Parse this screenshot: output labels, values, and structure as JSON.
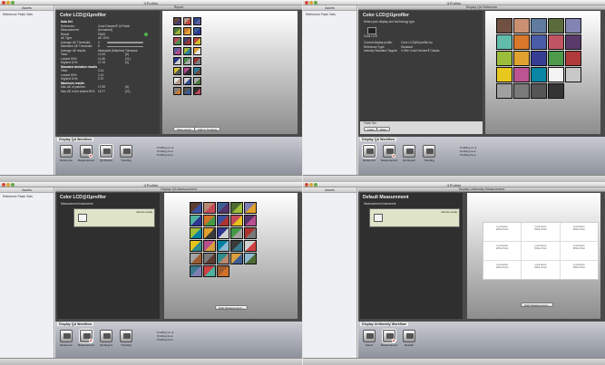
{
  "app": {
    "window_title": "i1Profiler",
    "sidebar_header": "Assets",
    "sidebar_item": "Reference Patch Sets"
  },
  "q1": {
    "header": "Report",
    "panel_title": "Color LCD@i1profiler",
    "rows": [
      {
        "label": "Data Set",
        "v": ""
      },
      {
        "label": "Reference:",
        "v": "ColorChecker® 24 Patch"
      },
      {
        "label": "Measurement:",
        "v": "(Unnamed)"
      },
      {
        "label": "Result",
        "v": "PASS"
      },
      {
        "label": "ΔE Type:",
        "v": "ΔE 1976"
      },
      {
        "label": "Average ΔE Threshold:",
        "v": "3"
      },
      {
        "label": "Maximum ΔE Threshold:",
        "v": "6"
      },
      {
        "label": "Average ΔE results",
        "v": "Measured (Matches)",
        "v2": "Tolerance"
      },
      {
        "label": "Total:",
        "v": "12.49",
        "v2": "(6)"
      },
      {
        "label": "Lowest 90%:",
        "v": "11.66",
        "v2": "(21)"
      },
      {
        "label": "Highest 10%:",
        "v": "17.15",
        "v2": "(3)"
      },
      {
        "label": "Standard deviation results",
        "v": ""
      },
      {
        "label": "Total:",
        "v": "3.14"
      },
      {
        "label": "Lowest 90%:",
        "v": "2.13"
      },
      {
        "label": "Highest 10%:",
        "v": "0.70"
      },
      {
        "label": "Maximum results",
        "v": ""
      },
      {
        "label": "Max ΔE of patches:",
        "v": "17.89",
        "v2": "(6)"
      },
      {
        "label": "Max ΔE in the lowest 90%:",
        "v": "15.77",
        "v2": "(21)"
      }
    ],
    "buttons": {
      "save": "Save report...",
      "trending": "Add to Trending"
    },
    "workflow_title": "Display QA Workflow",
    "steps": [
      "Reference",
      "Measurement",
      "QA Report",
      "Trending"
    ],
    "opts": [
      "Profiling mo",
      "Profiling ba",
      "Profiling ba"
    ],
    "colors": [
      "#6b4b3b",
      "#b89a8a",
      "#2f4a8f",
      "#4c7a3a",
      "#c87a2e",
      "#3b5c9c",
      "#ba4a5c",
      "#4a3f70",
      "#bd463c",
      "#5e5e9e",
      "#9fb23c",
      "#e3a23a",
      "#2d3a8f",
      "#4d8d4a",
      "#9a3535",
      "#d4bf2c",
      "#b14a8c",
      "#2c7d9a",
      "#e7e7e7",
      "#cfcfcf",
      "#a9a9a9",
      "#7c7c7c",
      "#555",
      "#2f2f2f"
    ]
  },
  "q2": {
    "header": "Display QA Reference",
    "panel_title": "Color LCD@i1profiler",
    "sub": "Select your display and technology type",
    "display_label": "Color LCD",
    "rows": [
      {
        "label": "Current display profile:",
        "v": "Color LCD@i1profiler.icc"
      },
      {
        "label": "Reference Type:",
        "v": "Standard"
      },
      {
        "label": "Industry Standard Targets:",
        "v": "X-Rite ColorChecker® Classic"
      }
    ],
    "buttons": {
      "load": "Load",
      "save": "Save"
    },
    "patch_set": "Patch Set",
    "workflow_title": "Display QA Workflow",
    "steps": [
      "Reference",
      "Measurement",
      "QA Report",
      "Trending"
    ],
    "opts": [
      "Profiling mo",
      "Profiling ba",
      "Profiling ba"
    ],
    "colors": [
      "#705040",
      "#c99172",
      "#5f7c9e",
      "#5a6c3c",
      "#8284b4",
      "#62bcaa",
      "#d9782a",
      "#4a5ca6",
      "#c05462",
      "#5a3a6a",
      "#9cbc3c",
      "#e0a22e",
      "#363e94",
      "#4c9a4a",
      "#b03a3a",
      "#e8c81e",
      "#bc5492",
      "#0886a4",
      "#f3f3f3",
      "#c8c8c8",
      "#a0a0a0",
      "#7a7a7a",
      "#555555",
      "#343434"
    ]
  },
  "q3": {
    "header": "Display QA Measurement",
    "panel_title": "Color LCD@i1profiler",
    "instrument_label": "Measurement Instrument",
    "device_label": "Device ready",
    "button": "Start Measurement...",
    "workflow_title": "Display QA Workflow",
    "steps": [
      "Reference",
      "Measurement",
      "QA Report",
      "Trending"
    ],
    "opts": [
      "Profiling mo",
      "Profiling ba",
      "Profiling ba"
    ],
    "colors": [
      "#5c3c30",
      "#b98870",
      "#3e5f94",
      "#4e6a33",
      "#7e7eb3",
      "#4fb2a0",
      "#d1722a",
      "#3c50a0",
      "#c54a58",
      "#55346a",
      "#9fbd38",
      "#e3a12c",
      "#2f3691",
      "#459945",
      "#ae3434",
      "#e7c21b",
      "#b84e8d",
      "#0080a1",
      "#3a3a3a",
      "#cfcfcf",
      "#a2a2a2",
      "#7a7a7a",
      "#2f8c8c",
      "#d9a040",
      "#8cb8d0",
      "#3a7a8c",
      "#d04040",
      "#9c5c30"
    ]
  },
  "q4": {
    "header": "Display Uniformity Measurement",
    "panel_title": "Default Measurement",
    "instrument_label": "Measurement Instrument",
    "device_label": "Device ready",
    "cells": [
      {
        "a": "Luminance",
        "b": "White Point"
      },
      {
        "a": "Luminance",
        "b": "White Point"
      },
      {
        "a": "Luminance",
        "b": "White Point"
      },
      {
        "a": "Luminance",
        "b": "White Point"
      },
      {
        "a": "Luminance",
        "b": "White Point"
      },
      {
        "a": "Luminance",
        "b": "White Point"
      },
      {
        "a": "Luminance",
        "b": "White Point"
      },
      {
        "a": "Luminance",
        "b": "White Point"
      },
      {
        "a": "Luminance",
        "b": "White Point"
      }
    ],
    "button": "Start Measurement...",
    "workflow_title": "Display Uniformity Workflow",
    "steps": [
      "Select",
      "Measurement",
      "Results"
    ]
  }
}
